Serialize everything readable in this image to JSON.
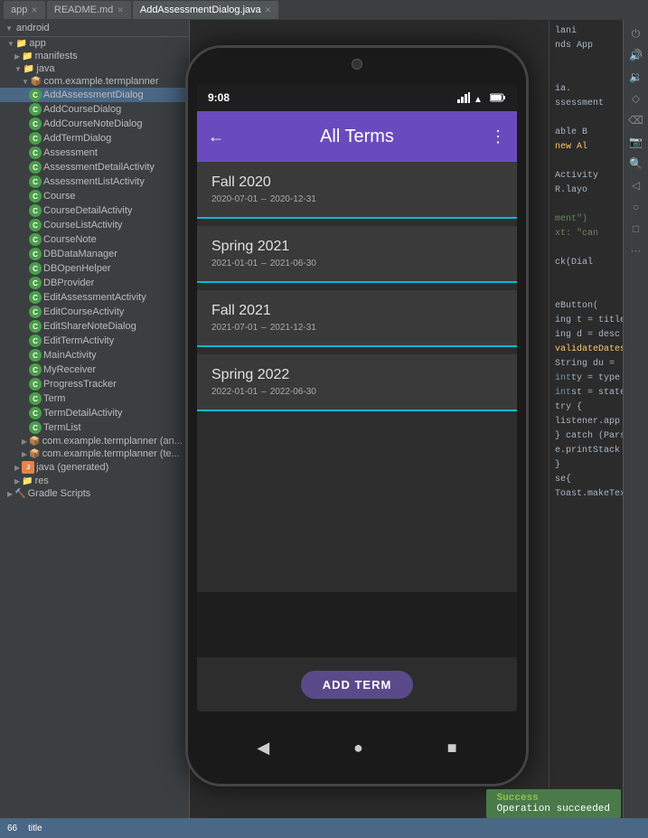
{
  "tabs": [
    {
      "label": "app",
      "active": false
    },
    {
      "label": "README.md",
      "active": false
    },
    {
      "label": "AddAssessmentDialog.java",
      "active": true
    }
  ],
  "file_tree": {
    "header": "android",
    "items": [
      {
        "indent": 1,
        "type": "folder",
        "label": "app",
        "expanded": true
      },
      {
        "indent": 2,
        "type": "folder",
        "label": "manifests",
        "expanded": false
      },
      {
        "indent": 2,
        "type": "folder",
        "label": "java",
        "expanded": true
      },
      {
        "indent": 3,
        "type": "folder",
        "label": "com.example.termplanner",
        "expanded": true
      },
      {
        "indent": 4,
        "type": "class",
        "label": "AddAssessmentDialog"
      },
      {
        "indent": 4,
        "type": "class",
        "label": "AddCourseDialog"
      },
      {
        "indent": 4,
        "type": "class",
        "label": "AddCourseNoteDialog"
      },
      {
        "indent": 4,
        "type": "class",
        "label": "AddTermDialog"
      },
      {
        "indent": 4,
        "type": "class",
        "label": "Assessment"
      },
      {
        "indent": 4,
        "type": "class",
        "label": "AssessmentDetailActivity"
      },
      {
        "indent": 4,
        "type": "class",
        "label": "AssessmentListActivity"
      },
      {
        "indent": 4,
        "type": "class",
        "label": "Course"
      },
      {
        "indent": 4,
        "type": "class",
        "label": "CourseDetailActivity"
      },
      {
        "indent": 4,
        "type": "class",
        "label": "CourseListActivity"
      },
      {
        "indent": 4,
        "type": "class",
        "label": "CourseNote"
      },
      {
        "indent": 4,
        "type": "class",
        "label": "DBDataManager"
      },
      {
        "indent": 4,
        "type": "class",
        "label": "DBOpenHelper"
      },
      {
        "indent": 4,
        "type": "class",
        "label": "DBProvider"
      },
      {
        "indent": 4,
        "type": "class",
        "label": "EditAssessmentActivity"
      },
      {
        "indent": 4,
        "type": "class",
        "label": "EditCourseActivity"
      },
      {
        "indent": 4,
        "type": "class",
        "label": "EditShareNoteDialog"
      },
      {
        "indent": 4,
        "type": "class",
        "label": "EditTermActivity"
      },
      {
        "indent": 4,
        "type": "class",
        "label": "MainActivity"
      },
      {
        "indent": 4,
        "type": "class",
        "label": "MyReceiver"
      },
      {
        "indent": 4,
        "type": "class",
        "label": "ProgressTracker"
      },
      {
        "indent": 4,
        "type": "class",
        "label": "Term"
      },
      {
        "indent": 4,
        "type": "class",
        "label": "TermDetailActivity"
      },
      {
        "indent": 4,
        "type": "class",
        "label": "TermList"
      },
      {
        "indent": 3,
        "type": "folder",
        "label": "com.example.termplanner (an...)",
        "expanded": false
      },
      {
        "indent": 3,
        "type": "folder",
        "label": "com.example.termplanner (te...)",
        "expanded": false
      },
      {
        "indent": 2,
        "type": "folder-java",
        "label": "java (generated)",
        "expanded": false
      },
      {
        "indent": 2,
        "type": "folder",
        "label": "res",
        "expanded": false
      },
      {
        "indent": 1,
        "type": "folder",
        "label": "Gradle Scripts",
        "expanded": false
      }
    ]
  },
  "phone": {
    "status_bar": {
      "time": "9:08",
      "icons": [
        "signal",
        "wifi",
        "battery"
      ]
    },
    "app_bar": {
      "title": "All Terms",
      "back_label": "←",
      "menu_label": "⋮"
    },
    "terms": [
      {
        "name": "Fall 2020",
        "start": "2020-07-01",
        "end": "2020-12-31"
      },
      {
        "name": "Spring 2021",
        "start": "2021-01-01",
        "end": "2021-06-30"
      },
      {
        "name": "Fall 2021",
        "start": "2021-07-01",
        "end": "2021-12-31"
      },
      {
        "name": "Spring 2022",
        "start": "2022-01-01",
        "end": "2022-06-30"
      }
    ],
    "add_term_button": "ADD TERM",
    "nav": {
      "back": "◀",
      "home": "●",
      "recent": "■"
    }
  },
  "code_panel": {
    "lines": [
      {
        "num": "",
        "text": "lani",
        "color": "white"
      },
      {
        "num": "",
        "text": "nds App",
        "color": "white"
      },
      {
        "num": "",
        "text": "",
        "color": "white"
      },
      {
        "num": "",
        "text": "",
        "color": "white"
      },
      {
        "num": "",
        "text": "iа.",
        "color": "white"
      },
      {
        "num": "",
        "text": "ssessment",
        "color": "white"
      },
      {
        "num": "",
        "text": "",
        "color": "white"
      },
      {
        "num": "",
        "text": "able B",
        "color": "white"
      },
      {
        "num": "",
        "text": "new Al",
        "color": "orange"
      },
      {
        "num": "",
        "text": "",
        "color": "white"
      },
      {
        "num": "",
        "text": "Activity",
        "color": "white"
      },
      {
        "num": "",
        "text": "R.layo",
        "color": "white"
      },
      {
        "num": "",
        "text": "",
        "color": "white"
      },
      {
        "num": "",
        "text": "ment\")",
        "color": "green"
      },
      {
        "num": "",
        "text": "xt: \"can",
        "color": "green"
      },
      {
        "num": "",
        "text": "",
        "color": "white"
      },
      {
        "num": "",
        "text": "ck(Dial",
        "color": "white"
      },
      {
        "num": "",
        "text": "",
        "color": "white"
      },
      {
        "num": "",
        "text": "",
        "color": "white"
      },
      {
        "num": "",
        "text": "eButton( text: \"App",
        "color": "white"
      },
      {
        "num": "",
        "text": "ing t = title.get",
        "color": "white"
      },
      {
        "num": "",
        "text": "ing d = descripti",
        "color": "white"
      },
      {
        "num": "",
        "text": "validateDates(due",
        "color": "yellow"
      },
      {
        "num": "",
        "text": "String du = due.",
        "color": "white"
      },
      {
        "num": "",
        "text": "int ty = type.ge",
        "color": "blue"
      },
      {
        "num": "",
        "text": "int st = state.g",
        "color": "blue"
      },
      {
        "num": "",
        "text": "try {",
        "color": "white"
      },
      {
        "num": "",
        "text": "  listener.app",
        "color": "white"
      },
      {
        "num": "",
        "text": "} catch (ParseEx",
        "color": "white"
      },
      {
        "num": "",
        "text": "  e.printStack",
        "color": "white"
      },
      {
        "num": "",
        "text": "}",
        "color": "white"
      },
      {
        "num": "",
        "text": "se{",
        "color": "white"
      },
      {
        "num": "",
        "text": "  Toast.makeText(g",
        "color": "white"
      }
    ]
  },
  "ide_status": {
    "line": "66",
    "title_key": "title",
    "success_label": "Success",
    "success_text": "Operation succeeded"
  },
  "toolbar_icons": [
    "power-icon",
    "speaker-icon",
    "volume-icon",
    "diamond-icon",
    "eraser-icon",
    "camera-icon",
    "search-icon",
    "back-icon",
    "circle-icon",
    "square-icon",
    "more-icon"
  ]
}
